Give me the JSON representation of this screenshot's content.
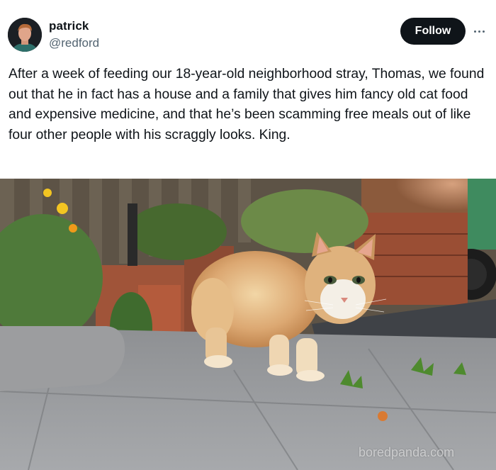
{
  "author": {
    "display_name": "patrick",
    "handle": "@redford"
  },
  "actions": {
    "follow_label": "Follow",
    "more_icon": "more-horizontal-icon"
  },
  "post": {
    "text": "After a week of feeding our 18-year-old neighborhood stray, Thomas, we found out that he in fact has a house and a family that gives him fancy old cat food and expensive medicine, and that he’s been scamming free meals out of like four other people with his scraggly looks. King."
  },
  "media": {
    "description_icon": "photo-orange-cat-on-patio",
    "watermark": "boredpanda.com"
  },
  "colors": {
    "follow_bg": "#0f1419",
    "text": "#0f1419",
    "secondary_text": "#536471"
  }
}
